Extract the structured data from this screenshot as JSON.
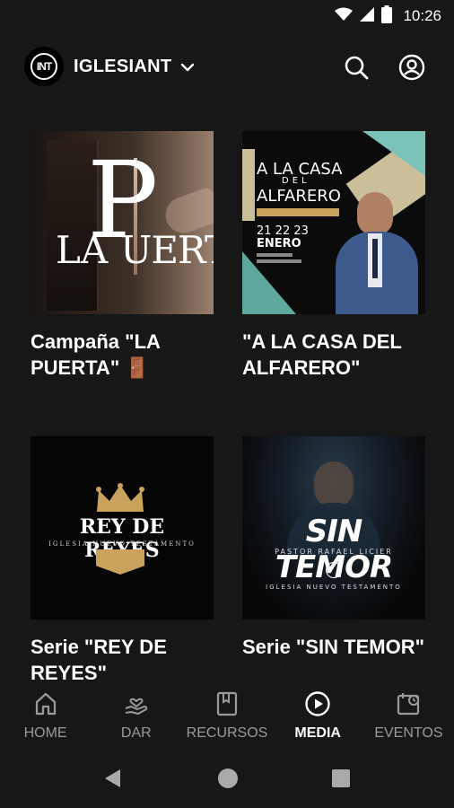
{
  "status": {
    "time": "10:26"
  },
  "header": {
    "brand": "IGLESIANT",
    "logo_text": "INT"
  },
  "cards": [
    {
      "title": "Campaña \"LA PUERTA\" 🚪",
      "poster": {
        "main": "LA",
        "big": "P",
        "rest": "UERTA"
      }
    },
    {
      "title": "\"A LA CASA DEL ALFARERO\"",
      "poster": {
        "l1": "A LA CASA",
        "l2": "DEL",
        "l3": "ALFARERO",
        "date_days": "21 22 23",
        "date_month": "ENERO"
      }
    },
    {
      "title": "Serie \"REY DE REYES\"",
      "poster": {
        "main": "REY DE REYES",
        "sub": "IGLESIA NUEVO TESTAMENTO"
      }
    },
    {
      "title": "Serie \"SIN TEMOR\"",
      "poster": {
        "main": "SIN TEMOR",
        "pastor": "PASTOR RAFAEL LICIER",
        "church": "IGLESIA NUEVO TESTAMENTO"
      }
    }
  ],
  "nav": [
    {
      "label": "HOME",
      "icon": "home-icon"
    },
    {
      "label": "DAR",
      "icon": "give-icon"
    },
    {
      "label": "RECURSOS",
      "icon": "resources-icon"
    },
    {
      "label": "MEDIA",
      "icon": "media-icon",
      "active": true
    },
    {
      "label": "EVENTOS",
      "icon": "events-icon"
    }
  ],
  "colors": {
    "background": "#171717",
    "inactive": "#9a9a9a",
    "gold": "#c9a35b",
    "teal": "#7bc3b8"
  }
}
